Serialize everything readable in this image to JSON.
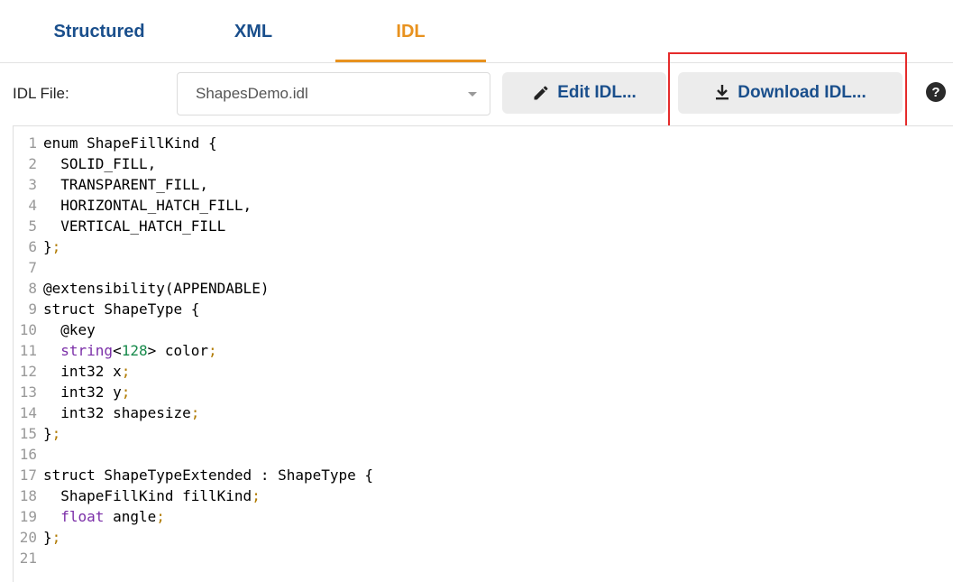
{
  "tabs": [
    {
      "label": "Structured",
      "active": false
    },
    {
      "label": "XML",
      "active": false
    },
    {
      "label": "IDL",
      "active": true
    }
  ],
  "toolbar": {
    "file_label": "IDL File:",
    "file_select_value": "ShapesDemo.idl",
    "edit_label": "Edit IDL...",
    "download_label": "Download IDL...",
    "help_icon": "?"
  },
  "colors": {
    "active_tab": "#e8921f",
    "accent": "#1a4f8c",
    "highlight_box": "#e52b2b",
    "keyword": "#7b2fa8",
    "number": "#178a4b",
    "punctuation": "#b07a00"
  },
  "icons": {
    "edit": "pencil-icon",
    "download": "download-icon",
    "help": "help-circle-icon",
    "dropdown": "chevron-down-icon"
  },
  "code_lines": [
    {
      "n": "1",
      "segments": [
        [
          "enum ShapeFillKind {",
          ""
        ]
      ]
    },
    {
      "n": "2",
      "segments": [
        [
          "  SOLID_FILL,",
          ""
        ]
      ]
    },
    {
      "n": "3",
      "segments": [
        [
          "  TRANSPARENT_FILL,",
          ""
        ]
      ]
    },
    {
      "n": "4",
      "segments": [
        [
          "  HORIZONTAL_HATCH_FILL,",
          ""
        ]
      ]
    },
    {
      "n": "5",
      "segments": [
        [
          "  VERTICAL_HATCH_FILL",
          ""
        ]
      ]
    },
    {
      "n": "6",
      "segments": [
        [
          "}",
          ""
        ],
        [
          ";",
          "punc"
        ]
      ]
    },
    {
      "n": "7",
      "segments": [
        [
          "",
          ""
        ]
      ]
    },
    {
      "n": "8",
      "segments": [
        [
          "@extensibility(APPENDABLE)",
          ""
        ]
      ]
    },
    {
      "n": "9",
      "segments": [
        [
          "struct ShapeType {",
          ""
        ]
      ]
    },
    {
      "n": "10",
      "segments": [
        [
          "  @key",
          ""
        ]
      ]
    },
    {
      "n": "11",
      "segments": [
        [
          "  ",
          ""
        ],
        [
          "string",
          "kw"
        ],
        [
          "<",
          ""
        ],
        [
          "128",
          "num"
        ],
        [
          "> color",
          ""
        ],
        [
          ";",
          "punc"
        ]
      ]
    },
    {
      "n": "12",
      "segments": [
        [
          "  int32 x",
          ""
        ],
        [
          ";",
          "punc"
        ]
      ]
    },
    {
      "n": "13",
      "segments": [
        [
          "  int32 y",
          ""
        ],
        [
          ";",
          "punc"
        ]
      ]
    },
    {
      "n": "14",
      "segments": [
        [
          "  int32 shapesize",
          ""
        ],
        [
          ";",
          "punc"
        ]
      ]
    },
    {
      "n": "15",
      "segments": [
        [
          "}",
          ""
        ],
        [
          ";",
          "punc"
        ]
      ]
    },
    {
      "n": "16",
      "segments": [
        [
          "",
          ""
        ]
      ]
    },
    {
      "n": "17",
      "segments": [
        [
          "struct ShapeTypeExtended : ShapeType {",
          ""
        ]
      ]
    },
    {
      "n": "18",
      "segments": [
        [
          "  ShapeFillKind fillKind",
          ""
        ],
        [
          ";",
          "punc"
        ]
      ]
    },
    {
      "n": "19",
      "segments": [
        [
          "  ",
          ""
        ],
        [
          "float",
          "kw"
        ],
        [
          " angle",
          ""
        ],
        [
          ";",
          "punc"
        ]
      ]
    },
    {
      "n": "20",
      "segments": [
        [
          "}",
          ""
        ],
        [
          ";",
          "punc"
        ]
      ]
    },
    {
      "n": "21",
      "segments": [
        [
          "",
          ""
        ]
      ]
    }
  ]
}
